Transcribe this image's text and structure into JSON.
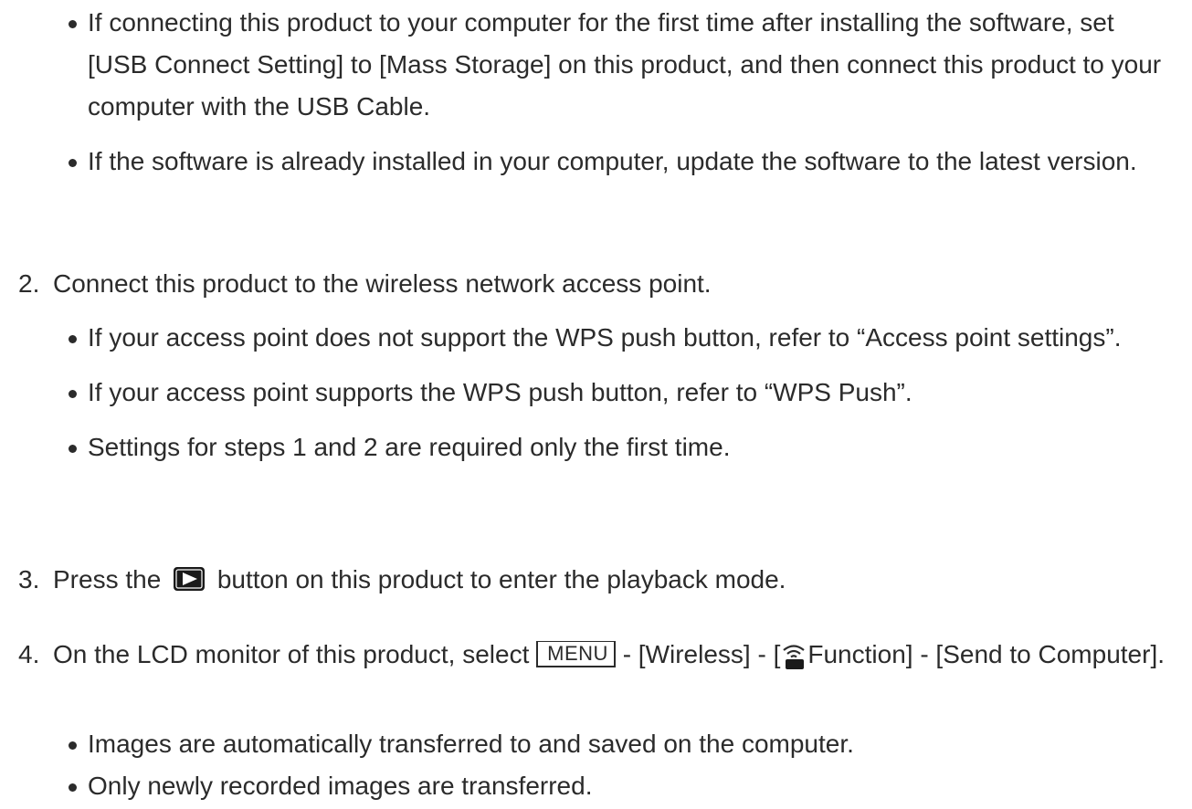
{
  "intro_bullets": [
    "If connecting this product to your computer for the first time after installing the software, set [USB Connect Setting] to [Mass Storage] on this product, and then connect this product to your computer with the USB Cable.",
    "If the software is already installed in your computer, update the software to the latest version."
  ],
  "step2": {
    "number": "2.",
    "text": "Connect this product to the wireless network access point.",
    "bullets": [
      "If your access point does not support the WPS push button, refer to “Access point settings”.",
      "If your access point supports the WPS push button, refer to “WPS Push”.",
      "Settings for steps 1 and 2 are required only the first time."
    ]
  },
  "step3": {
    "number": "3.",
    "text_before": "Press the",
    "icon": "playback-button-icon",
    "text_after": "button on this product to enter the playback mode."
  },
  "step4": {
    "number": "4.",
    "text_before": "On the LCD monitor of this product, select",
    "menu_label": "MENU",
    "text_middle": "- [Wireless] - [",
    "icon": "wireless-function-icon",
    "text_after": "Function] - [Send to Computer].",
    "bullets": [
      "Images are automatically transferred to and saved on the computer.",
      "Only newly recorded images are transferred."
    ]
  }
}
